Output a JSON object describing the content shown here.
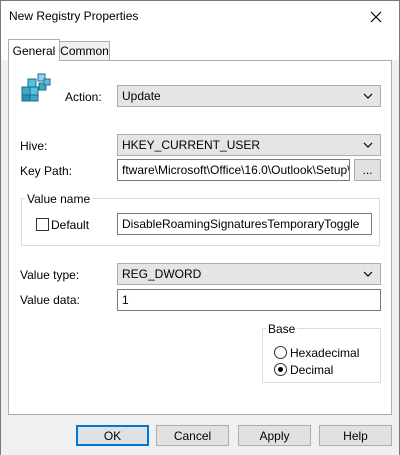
{
  "window": {
    "title": "New Registry Properties"
  },
  "tabs": [
    {
      "label": "General"
    },
    {
      "label": "Common"
    }
  ],
  "action": {
    "label": "Action:",
    "value": "Update"
  },
  "hive": {
    "label": "Hive:",
    "value": "HKEY_CURRENT_USER"
  },
  "key_path": {
    "label": "Key Path:",
    "value": "ftware\\Microsoft\\Office\\16.0\\Outlook\\Setup\\",
    "browse_label": "..."
  },
  "value_name": {
    "group_title": "Value name",
    "default_label": "Default",
    "default_checked": false,
    "value": "DisableRoamingSignaturesTemporaryToggle"
  },
  "value_type": {
    "label": "Value type:",
    "value": "REG_DWORD"
  },
  "value_data": {
    "label": "Value data:",
    "value": "1"
  },
  "base": {
    "group_title": "Base",
    "options": [
      {
        "label": "Hexadecimal",
        "checked": false
      },
      {
        "label": "Decimal",
        "checked": true
      }
    ]
  },
  "buttons": {
    "ok": "OK",
    "cancel": "Cancel",
    "apply": "Apply",
    "help": "Help"
  }
}
